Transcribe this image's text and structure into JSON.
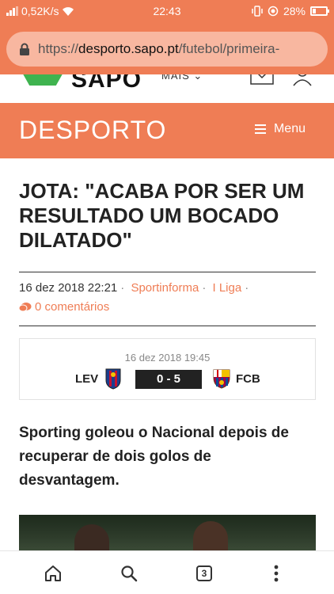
{
  "status_bar": {
    "net_speed": "0,52K/s",
    "time": "22:43",
    "battery": "28%",
    "battery_level": 0.28
  },
  "browser": {
    "url_scheme": "https://",
    "url_host": "desporto.sapo.pt",
    "url_path": "/futebol/primeira-",
    "tab_count": "3"
  },
  "site": {
    "logo_text": "SAPO",
    "mais_label": "MAIS",
    "section_title": "DESPORTO",
    "menu_label": "Menu",
    "accent_color": "#ef7d55"
  },
  "article": {
    "headline": "JOTA: \"ACABA POR SER UM RESULTADO UM BOCADO DILATADO\"",
    "date": "16 dez 2018 22:21",
    "source": "Sportinforma",
    "category": "I Liga",
    "comments": "0 comentários",
    "lead": "Sporting goleou o Nacional depois de recuperar de dois golos de desvantagem."
  },
  "match": {
    "date": "16 dez 2018 19:45",
    "home": "LEV",
    "away": "FCB",
    "score": "0 - 5"
  }
}
